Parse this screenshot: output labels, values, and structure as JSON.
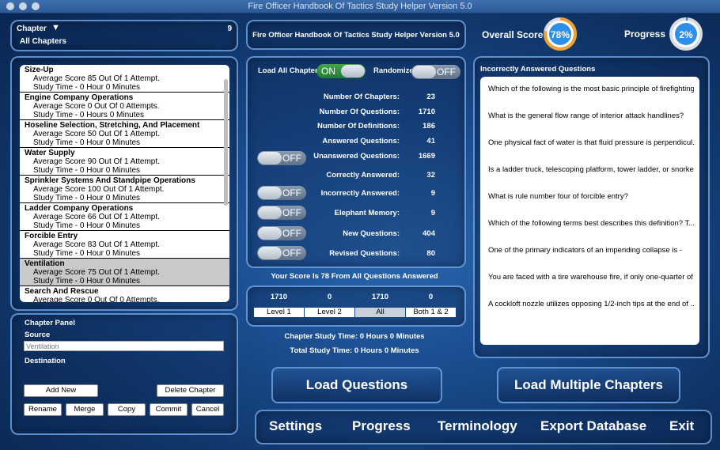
{
  "window": {
    "title": "Fire Officer Handbook Of Tactics Study Helper Version 5.0"
  },
  "left": {
    "chapter_label": "Chapter",
    "chapter_count": "9",
    "all_chapters": "All Chapters",
    "chapters": [
      {
        "name": "Size-Up",
        "score": "Average Score 85 Out Of 1 Attempt.",
        "time": "Study Time - 0 Hour 0 Minutes"
      },
      {
        "name": "Engine Company Operations",
        "score": "Average Score 0 Out Of 0 Attempts.",
        "time": "Study Time - 0 Hours 0 Minutes"
      },
      {
        "name": "Hoseline Selection, Stretching, And Placement",
        "score": "Average Score 50 Out Of 1 Attempt.",
        "time": "Study Time - 0 Hour 0 Minutes"
      },
      {
        "name": "Water Supply",
        "score": "Average Score 90 Out Of 1 Attempt.",
        "time": "Study Time - 0 Hour 0 Minutes"
      },
      {
        "name": "Sprinkler Systems And Standpipe Operations",
        "score": "Average Score 100 Out Of 1 Attempt.",
        "time": "Study Time - 0 Hour 0 Minutes"
      },
      {
        "name": "Ladder Company Operations",
        "score": "Average Score 66 Out Of 1 Attempt.",
        "time": "Study Time - 0 Hour 0 Minutes"
      },
      {
        "name": "Forcible Entry",
        "score": "Average Score 83 Out Of 1 Attempt.",
        "time": "Study Time - 0 Hour 0 Minutes"
      },
      {
        "name": "Ventilation",
        "score": "Average Score 75 Out Of 1 Attempt.",
        "time": "Study Time - 0 Hour 0 Minutes"
      },
      {
        "name": "Search And Rescue",
        "score": "Average Score 0 Out Of 0 Attempts.",
        "time": ""
      }
    ],
    "chapter_panel_label": "Chapter Panel",
    "source_label": "Source",
    "source_placeholder": "Ventilation",
    "destination_label": "Destination",
    "buttons": {
      "add_new": "Add New",
      "delete_chapter": "Delete Chapter",
      "rename": "Rename",
      "merge": "Merge",
      "copy": "Copy",
      "commit": "Commit",
      "cancel": "Cancel"
    }
  },
  "center": {
    "header_title": "Fire Officer Handbook Of Tactics Study Helper Version 5.0",
    "load_all_label": "Load All Chapters",
    "randomize_label": "Randomize",
    "on_text": "ON",
    "off_text": "OFF",
    "stats": [
      {
        "label": "Number Of Chapters:",
        "value": "23"
      },
      {
        "label": "Number Of Questions:",
        "value": "1710"
      },
      {
        "label": "Number Of Definitions:",
        "value": "186"
      },
      {
        "label": "Answered Questions:",
        "value": "41"
      },
      {
        "label": "Unanswered Questions:",
        "value": "1669"
      },
      {
        "label": "Correctly Answered:",
        "value": "32"
      },
      {
        "label": "Incorrectly Answered:",
        "value": "9"
      },
      {
        "label": "Elephant Memory:",
        "value": "9"
      },
      {
        "label": "New Questions:",
        "value": "404"
      },
      {
        "label": "Revised Questions:",
        "value": "80"
      }
    ],
    "score_text": "Your Score Is 78 From All Questions Answered",
    "level_counts": [
      "1710",
      "0",
      "1710",
      "0"
    ],
    "levels": [
      "Level 1",
      "Level 2",
      "All",
      "Both 1 & 2"
    ],
    "chapter_study_time": "Chapter Study Time: 0 Hours 0 Minutes",
    "total_study_time": "Total Study Time: 0 Hours 0 Minutes"
  },
  "right": {
    "overall_score_label": "Overall Score",
    "overall_score": "78%",
    "overall_score_fraction": 0.78,
    "progress_label": "Progress",
    "progress": "2%",
    "progress_fraction": 0.02,
    "incorrect_title": "Incorrectly Answered Questions",
    "incorrect_questions": [
      "Which of the following is the most basic principle of firefighting?",
      "What is the general flow range of interior attack handlines?",
      "One physical fact of water is that fluid pressure is perpendicul...",
      "Is a ladder truck, telescoping platform, tower ladder, or snorke...",
      "What is rule number four of forcible entry?",
      "Which of the following terms best describes this definition?  T...",
      "One of the primary indicators of an impending collapse is -",
      "You are faced with a tire warehouse fire, if only one-quarter of ...",
      "A cockloft nozzle utilizes opposing 1/2-inch tips at the end of ..."
    ]
  },
  "actions": {
    "load_questions": "Load Questions",
    "load_multiple": "Load Multiple Chapters"
  },
  "menu": [
    "Settings",
    "Progress",
    "Terminology",
    "Export Database",
    "Exit"
  ],
  "colors": {
    "gauge_orange": "#f0a030",
    "gauge_blue": "#2d8fe8",
    "toggle_on": "#2f9a3c"
  }
}
